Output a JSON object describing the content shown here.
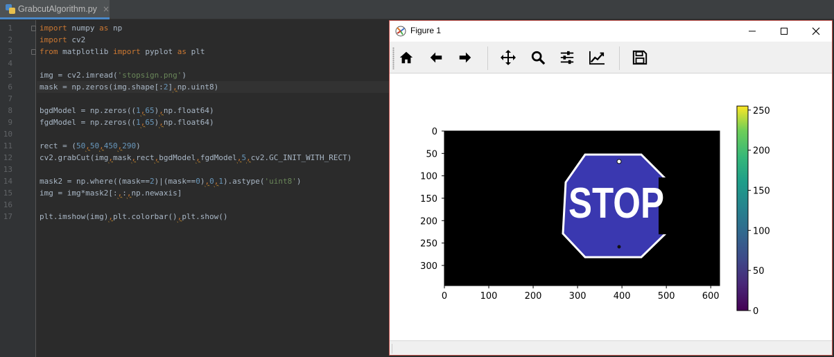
{
  "editor": {
    "tab": {
      "filename": "GrabcutAlgorithm.py",
      "close": "×"
    },
    "line_numbers": [
      "1",
      "2",
      "3",
      "4",
      "5",
      "6",
      "7",
      "8",
      "9",
      "10",
      "11",
      "12",
      "13",
      "14",
      "15",
      "16",
      "17"
    ],
    "lines": [
      [
        {
          "t": "import",
          "c": "kw"
        },
        {
          "t": " numpy ",
          "c": ""
        },
        {
          "t": "as",
          "c": "kw"
        },
        {
          "t": " np",
          "c": ""
        }
      ],
      [
        {
          "t": "import",
          "c": "kw"
        },
        {
          "t": " cv2",
          "c": ""
        }
      ],
      [
        {
          "t": "from",
          "c": "kw"
        },
        {
          "t": " matplotlib ",
          "c": ""
        },
        {
          "t": "import",
          "c": "kw"
        },
        {
          "t": " pyplot ",
          "c": ""
        },
        {
          "t": "as",
          "c": "kw"
        },
        {
          "t": " plt",
          "c": ""
        }
      ],
      [],
      [
        {
          "t": "img = cv2.imread(",
          "c": ""
        },
        {
          "t": "'stopsign.png'",
          "c": "str"
        },
        {
          "t": ")",
          "c": ""
        }
      ],
      [
        {
          "t": "mask = np.zeros(img.shape[:",
          "c": ""
        },
        {
          "t": "2",
          "c": "num"
        },
        {
          "t": "]",
          "c": ""
        },
        {
          "t": ",",
          "c": "cm"
        },
        {
          "t": "np.uint8)",
          "c": ""
        }
      ],
      [],
      [
        {
          "t": "bgdModel = np.zeros((",
          "c": ""
        },
        {
          "t": "1",
          "c": "num"
        },
        {
          "t": ",",
          "c": "cm"
        },
        {
          "t": "65",
          "c": "num"
        },
        {
          "t": ")",
          "c": ""
        },
        {
          "t": ",",
          "c": "cm"
        },
        {
          "t": "np.float64)",
          "c": ""
        }
      ],
      [
        {
          "t": "fgdModel = np.zeros((",
          "c": ""
        },
        {
          "t": "1",
          "c": "num"
        },
        {
          "t": ",",
          "c": "cm"
        },
        {
          "t": "65",
          "c": "num"
        },
        {
          "t": ")",
          "c": ""
        },
        {
          "t": ",",
          "c": "cm"
        },
        {
          "t": "np.float64)",
          "c": ""
        }
      ],
      [],
      [
        {
          "t": "rect = (",
          "c": ""
        },
        {
          "t": "50",
          "c": "num"
        },
        {
          "t": ",",
          "c": "cm"
        },
        {
          "t": "50",
          "c": "num"
        },
        {
          "t": ",",
          "c": "cm"
        },
        {
          "t": "450",
          "c": "num"
        },
        {
          "t": ",",
          "c": "cm"
        },
        {
          "t": "290",
          "c": "num"
        },
        {
          "t": ")",
          "c": ""
        }
      ],
      [
        {
          "t": "cv2.grabCut(img",
          "c": ""
        },
        {
          "t": ",",
          "c": "cm"
        },
        {
          "t": "mask",
          "c": ""
        },
        {
          "t": ",",
          "c": "cm"
        },
        {
          "t": "rect",
          "c": ""
        },
        {
          "t": ",",
          "c": "cm"
        },
        {
          "t": "bgdModel",
          "c": ""
        },
        {
          "t": ",",
          "c": "cm"
        },
        {
          "t": "fgdModel",
          "c": ""
        },
        {
          "t": ",",
          "c": "cm"
        },
        {
          "t": "5",
          "c": "num"
        },
        {
          "t": ",",
          "c": "cm"
        },
        {
          "t": "cv2.GC_INIT_WITH_RECT)",
          "c": ""
        }
      ],
      [],
      [
        {
          "t": "mask2 = np.where((mask==",
          "c": ""
        },
        {
          "t": "2",
          "c": "num"
        },
        {
          "t": ")|(mask==",
          "c": ""
        },
        {
          "t": "0",
          "c": "num"
        },
        {
          "t": ")",
          "c": ""
        },
        {
          "t": ",",
          "c": "cm"
        },
        {
          "t": "0",
          "c": "num"
        },
        {
          "t": ",",
          "c": "cm"
        },
        {
          "t": "1",
          "c": "num"
        },
        {
          "t": ").astype(",
          "c": ""
        },
        {
          "t": "'uint8'",
          "c": "str"
        },
        {
          "t": ")",
          "c": ""
        }
      ],
      [
        {
          "t": "img = img*mask2[:",
          "c": ""
        },
        {
          "t": ",",
          "c": "cm"
        },
        {
          "t": ":",
          "c": ""
        },
        {
          "t": ",",
          "c": "cm"
        },
        {
          "t": "np.newaxis]",
          "c": ""
        }
      ],
      [],
      [
        {
          "t": "plt.imshow(img)",
          "c": ""
        },
        {
          "t": ",",
          "c": "cm"
        },
        {
          "t": "plt.colorbar()",
          "c": ""
        },
        {
          "t": ",",
          "c": "cm"
        },
        {
          "t": "plt.show()",
          "c": ""
        }
      ]
    ],
    "current_line": 6
  },
  "figure_window": {
    "title": "Figure 1",
    "toolbar": [
      "home-icon",
      "back-arrow-icon",
      "forward-arrow-icon",
      "pan-icon",
      "zoom-icon",
      "configure-subplots-icon",
      "edit-axes-icon",
      "save-icon"
    ],
    "stop_sign_text": "STOP",
    "colors": {
      "stop_blue": "#3a38b0",
      "frame_red": "#c0504a"
    }
  },
  "chart_data": {
    "type": "heatmap",
    "image_axes": {
      "x_ticks": [
        0,
        100,
        200,
        300,
        400,
        500,
        600
      ],
      "y_ticks": [
        0,
        50,
        100,
        150,
        200,
        250,
        300
      ],
      "xlim": [
        0,
        620
      ],
      "ylim": [
        345,
        0
      ]
    },
    "colorbar": {
      "ticks": [
        0,
        50,
        100,
        150,
        200,
        250
      ],
      "range": [
        0,
        255
      ],
      "colormap": "viridis"
    }
  }
}
